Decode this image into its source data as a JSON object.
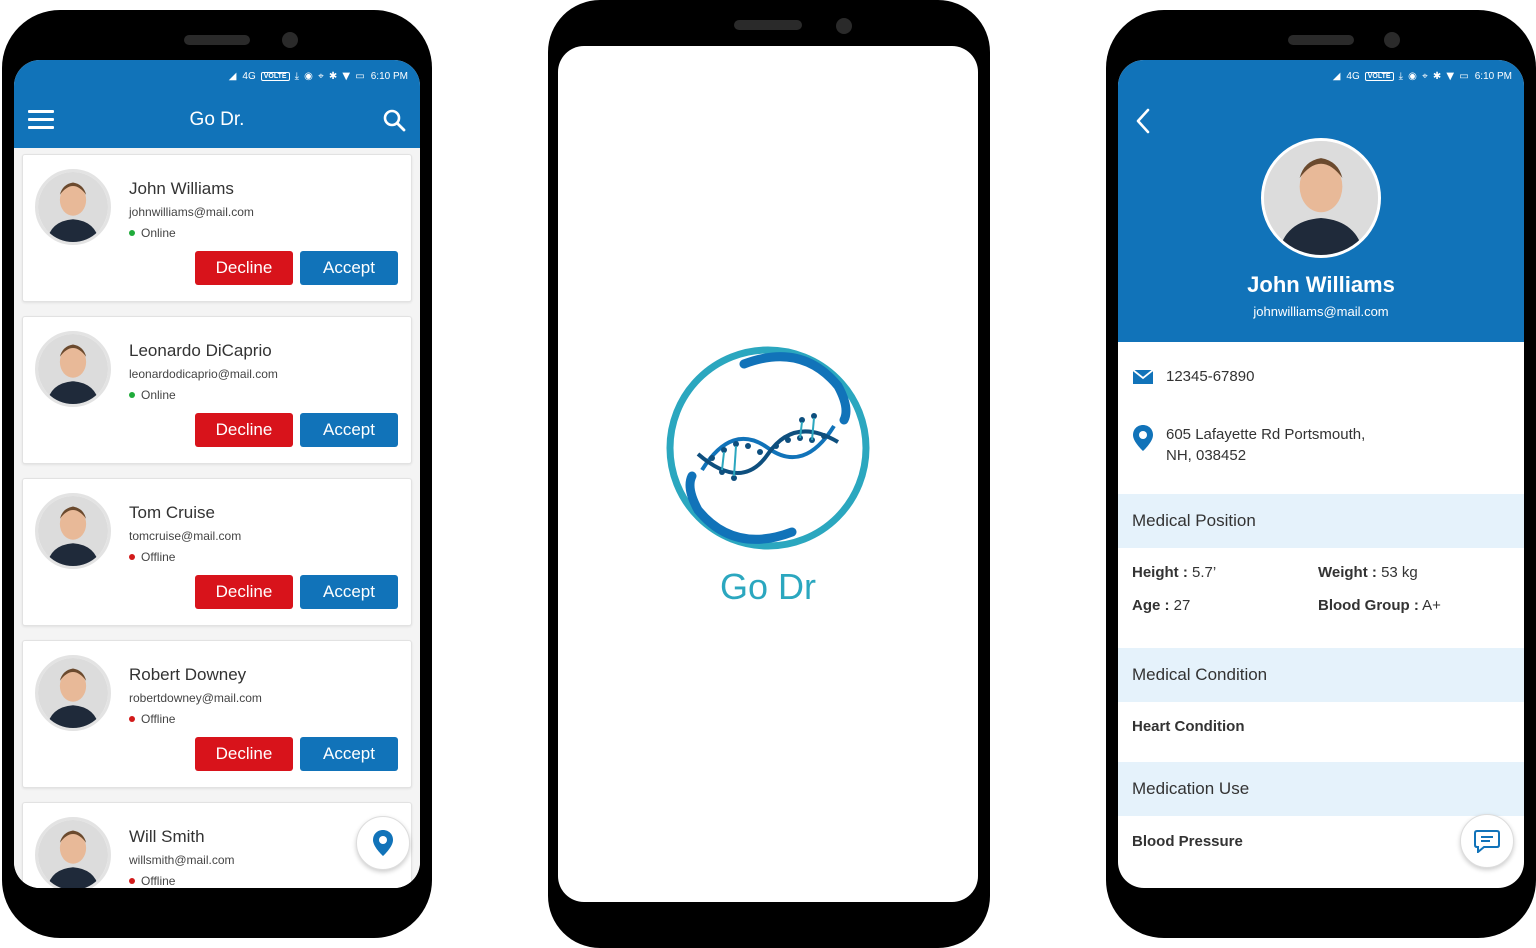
{
  "status_bar": {
    "signal": "4G",
    "volte": "VOLTE",
    "time": "6:10 PM"
  },
  "left_screen": {
    "title": "Go Dr.",
    "requests": [
      {
        "name": "John Williams",
        "email": "johnwilliams@mail.com",
        "status": "Online",
        "decline": "Decline",
        "accept": "Accept"
      },
      {
        "name": "Leonardo DiCaprio",
        "email": "leonardodicaprio@mail.com",
        "status": "Online",
        "decline": "Decline",
        "accept": "Accept"
      },
      {
        "name": "Tom Cruise",
        "email": "tomcruise@mail.com",
        "status": "Offline",
        "decline": "Decline",
        "accept": "Accept"
      },
      {
        "name": "Robert Downey",
        "email": "robertdowney@mail.com",
        "status": "Offline",
        "decline": "Decline",
        "accept": "Accept"
      },
      {
        "name": "Will Smith",
        "email": "willsmith@mail.com",
        "status": "Offline"
      }
    ]
  },
  "splash": {
    "title": "Go Dr"
  },
  "profile": {
    "name": "John Williams",
    "email": "johnwilliams@mail.com",
    "phone": "12345-67890",
    "address_line1": "605 Lafayette Rd Portsmouth,",
    "address_line2": "NH, 038452",
    "medical_position": {
      "heading": "Medical Position",
      "height_label": "Height :",
      "height": "5.7’",
      "weight_label": "Weight :",
      "weight": "53 kg",
      "age_label": "Age :",
      "age": "27",
      "blood_label": "Blood Group :",
      "blood": "A+"
    },
    "medical_condition": {
      "heading": "Medical Condition",
      "value": "Heart Condition"
    },
    "medication_use": {
      "heading": "Medication Use",
      "value": "Blood Pressure"
    }
  },
  "colors": {
    "primary": "#1173b9",
    "decline": "#d8131b",
    "online": "#1fab3a",
    "offline": "#d21a1a",
    "splash_text": "#2ba7bf",
    "section_bg": "#e5f2fb"
  },
  "icons": [
    "menu-icon",
    "search-icon",
    "location-pin-icon",
    "back-chevron-icon",
    "mail-icon",
    "chat-icon",
    "dna-logo-icon"
  ]
}
